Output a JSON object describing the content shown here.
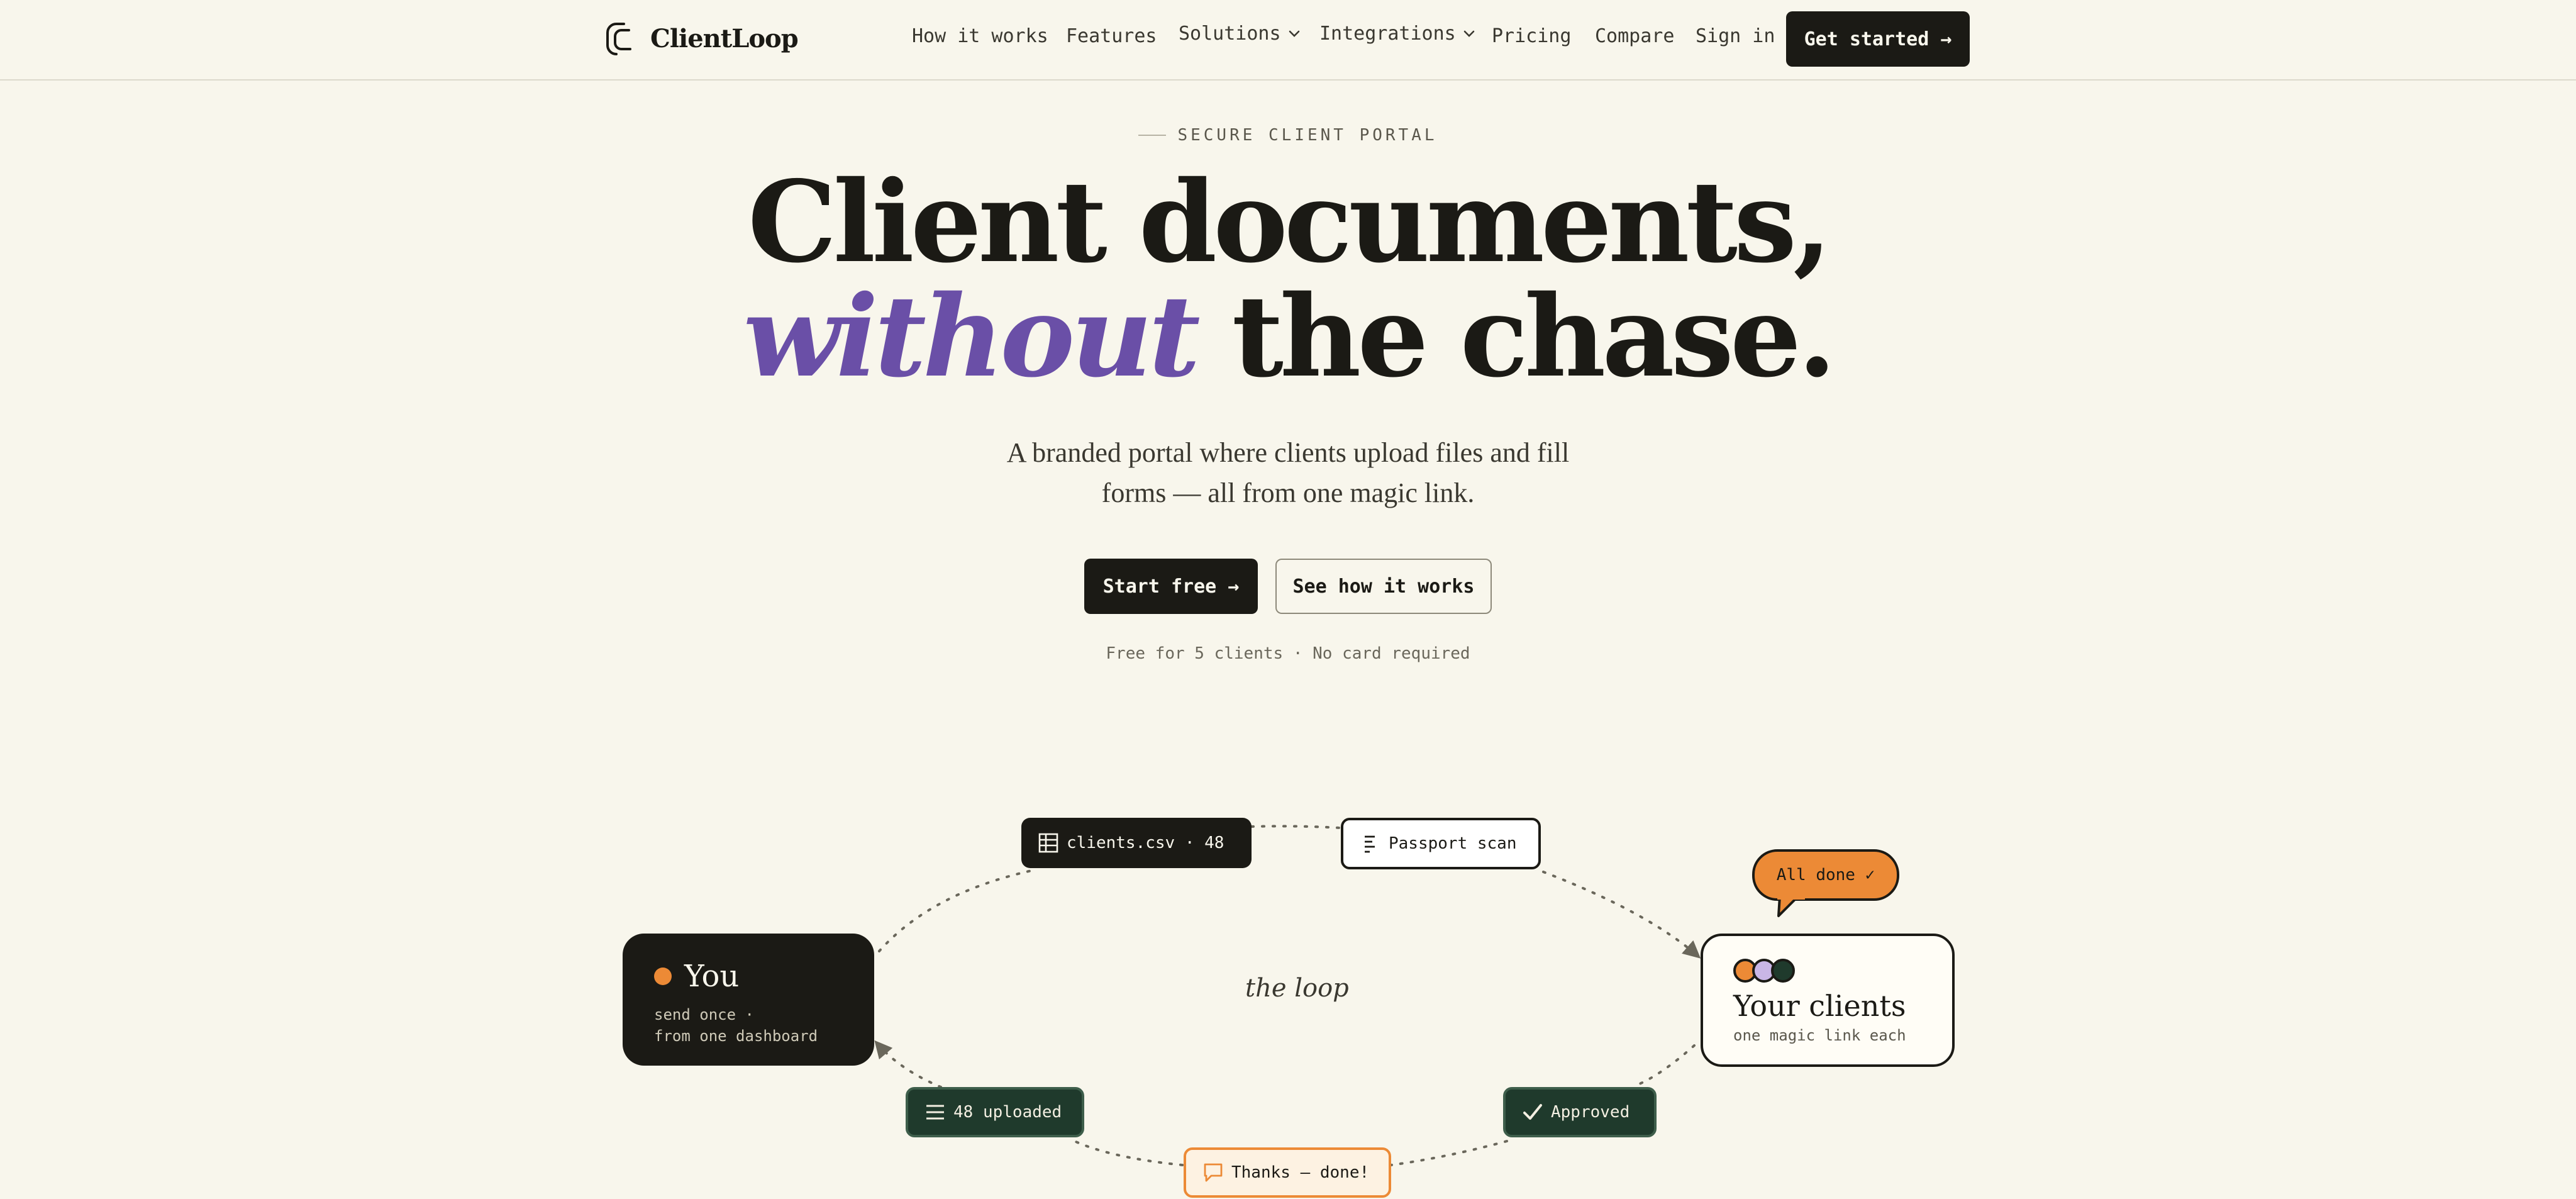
{
  "nav": {
    "brand": "ClientLoop",
    "links": [
      {
        "label": "How it works",
        "dropdown": false
      },
      {
        "label": "Features",
        "dropdown": false
      },
      {
        "label": "Solutions",
        "dropdown": true
      },
      {
        "label": "Integrations",
        "dropdown": true
      },
      {
        "label": "Pricing",
        "dropdown": false
      },
      {
        "label": "Compare",
        "dropdown": false
      },
      {
        "label": "Sign in",
        "dropdown": false
      }
    ],
    "cta": "Get started →"
  },
  "hero": {
    "eyebrow": "SECURE CLIENT PORTAL",
    "headline_line1": "Client documents,",
    "headline_accent": "without",
    "headline_rest": " the chase.",
    "subtitle": "A branded portal where clients upload files and fill forms — all from one magic link.",
    "primary_cta": "Start free →",
    "secondary_cta": "See how it works",
    "fineprint": "Free for 5 clients · No card required"
  },
  "loop": {
    "center_label": "the loop",
    "you": {
      "title": "You",
      "subtitle_line1": "send once ·",
      "subtitle_line2": "from one dashboard"
    },
    "clients": {
      "title": "Your clients",
      "subtitle": "one magic link each",
      "avatar_colors": [
        "#ec8a36",
        "#c9b6e6",
        "#1f3a2c"
      ]
    },
    "chips": {
      "csv": "clients.csv · 48",
      "passport": "Passport scan",
      "all_done": "All done ✓",
      "approved": "Approved",
      "thanks": "Thanks — done!",
      "uploaded": "48 uploaded"
    }
  },
  "colors": {
    "background": "#f8f6ec",
    "ink": "#1b1a15",
    "accent_purple": "#6a4fa7",
    "accent_orange": "#ec8a36",
    "deep_green": "#1f3a2c"
  }
}
